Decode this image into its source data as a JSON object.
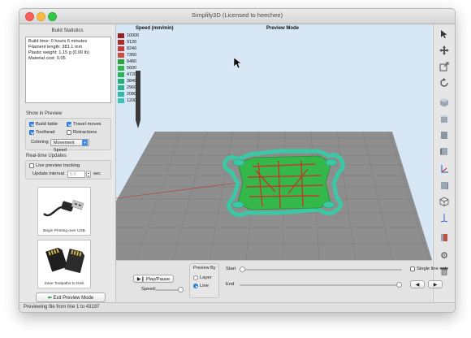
{
  "window": {
    "title": "Simplify3D (Licensed to heechee)"
  },
  "build_stats": {
    "title": "Build Statistics",
    "lines": [
      "Build time: 0 hours 6 minutes",
      "Filament length: 381.1 mm",
      "Plastic weight: 1.15 g (0.00 lb)",
      "Material cost: 0.05"
    ]
  },
  "show_in_preview": {
    "title": "Show in Preview",
    "options": [
      {
        "label": "Build table",
        "checked": true
      },
      {
        "label": "Travel moves",
        "checked": true
      },
      {
        "label": "Toolhead",
        "checked": true
      },
      {
        "label": "Retractions",
        "checked": false
      }
    ],
    "coloring_label": "Coloring",
    "coloring_value": "Movement Speed"
  },
  "realtime": {
    "title": "Real-time Updates",
    "live_label": "Live preview tracking",
    "live_checked": false,
    "interval_label": "Update interval",
    "interval_value": "5.0",
    "interval_unit": "sec"
  },
  "cards": {
    "usb_caption": "Begin Printing over USB",
    "sd_caption": "Save Toolpaths to Disk"
  },
  "exit_button": "Exit Preview Mode",
  "viewport": {
    "mode_label": "Preview Mode",
    "legend_title": "Speed (mm/min)",
    "legend": [
      {
        "value": "10000",
        "color": "#9c1f1f"
      },
      {
        "value": "9120",
        "color": "#b02a28"
      },
      {
        "value": "8240",
        "color": "#c53a33"
      },
      {
        "value": "7360",
        "color": "#d24b3c"
      },
      {
        "value": "6480",
        "color": "#2fa23a"
      },
      {
        "value": "5600",
        "color": "#36b445"
      },
      {
        "value": "4720",
        "color": "#2ab35a"
      },
      {
        "value": "3840",
        "color": "#27b071"
      },
      {
        "value": "2960",
        "color": "#2ab28a"
      },
      {
        "value": "2080",
        "color": "#30b8a0"
      },
      {
        "value": "1200",
        "color": "#3cc2b4"
      }
    ],
    "colors": {
      "sky": "#d7e7f6",
      "bed": "#8e8e8e",
      "bed_grid": "#7a7a7a",
      "brim": "#3cc8a4",
      "part": "#34b84a",
      "fast": "#c0392b"
    }
  },
  "toolbar": {
    "icons": [
      "cursor-icon",
      "move-icon",
      "scale-icon",
      "rotate-icon",
      "view-iso-icon",
      "view-front-icon",
      "view-back-icon",
      "view-left-icon",
      "view-right-icon",
      "view-top-icon",
      "view-bottom-icon",
      "wireframe-icon",
      "axes-icon",
      "cross-section-icon",
      "settings-gear-icon",
      "trash-icon"
    ]
  },
  "bottom": {
    "play_label": "Play/Pause",
    "speed_label": "Speed:",
    "preview_by_label": "Preview By",
    "layer_label": "Layer",
    "line_label": "Line",
    "preview_by_selected": "Line",
    "start_label": "Start",
    "end_label": "End",
    "single_line_label": "Single line only",
    "prev_glyph": "◀",
    "next_glyph": "▶"
  },
  "status": {
    "text": "Previewing file from line 1 to 43197"
  }
}
